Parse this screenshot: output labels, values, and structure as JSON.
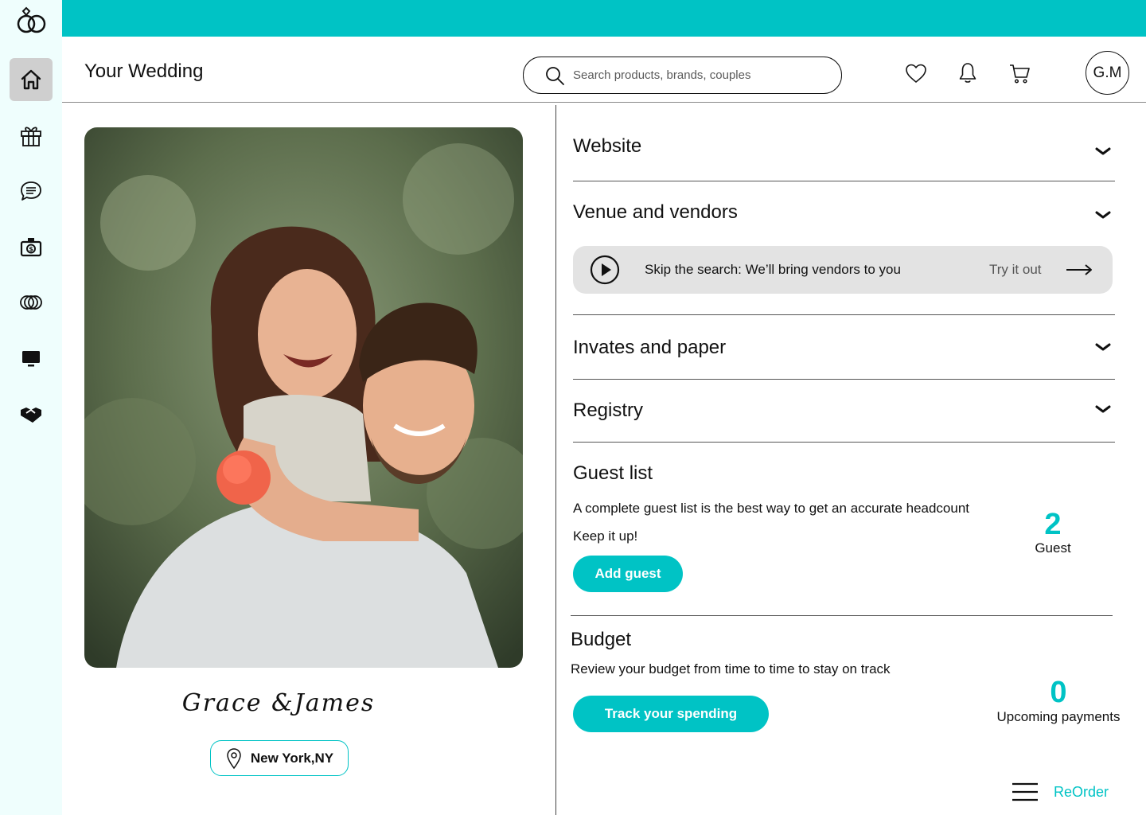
{
  "sidebar": {
    "logo": "wedding-rings-logo",
    "items": [
      {
        "icon": "home-icon",
        "active": true
      },
      {
        "icon": "gift-icon",
        "active": false
      },
      {
        "icon": "chat-icon",
        "active": false
      },
      {
        "icon": "camera-icon",
        "active": false
      },
      {
        "icon": "rings-icon",
        "active": false
      },
      {
        "icon": "monitor-icon",
        "active": false
      },
      {
        "icon": "handshake-icon",
        "active": false
      }
    ]
  },
  "header": {
    "title": "Your Wedding",
    "search_placeholder": "Search products, brands, couples",
    "avatar_initials": "G.M",
    "icons": [
      "heart-icon",
      "bell-icon",
      "cart-icon"
    ]
  },
  "profile": {
    "couple_names": "Grace &James",
    "location": "New York,NY"
  },
  "sections": {
    "website": "Website",
    "venue": "Venue and vendors",
    "invites": "Invates and paper",
    "registry": "Registry"
  },
  "promo": {
    "text": "Skip the search: We’ll bring vendors to you",
    "cta": "Try it out"
  },
  "guest_list": {
    "title": "Guest list",
    "description": "A complete guest list is the best way to get an accurate headcount",
    "encouragement": "Keep it up!",
    "count": "2",
    "count_label": "Guest",
    "button": "Add guest"
  },
  "budget": {
    "title": "Budget",
    "description": "Review your budget from time to time to stay on track",
    "count": "0",
    "count_label": "Upcoming payments",
    "button": "Track your spending"
  },
  "footer": {
    "reorder_label": "ReOrder"
  },
  "colors": {
    "accent": "#00c3c5",
    "sidebar_bg": "#effefd",
    "active_item": "#cfcfcf",
    "promo_bg": "#e3e3e3"
  }
}
